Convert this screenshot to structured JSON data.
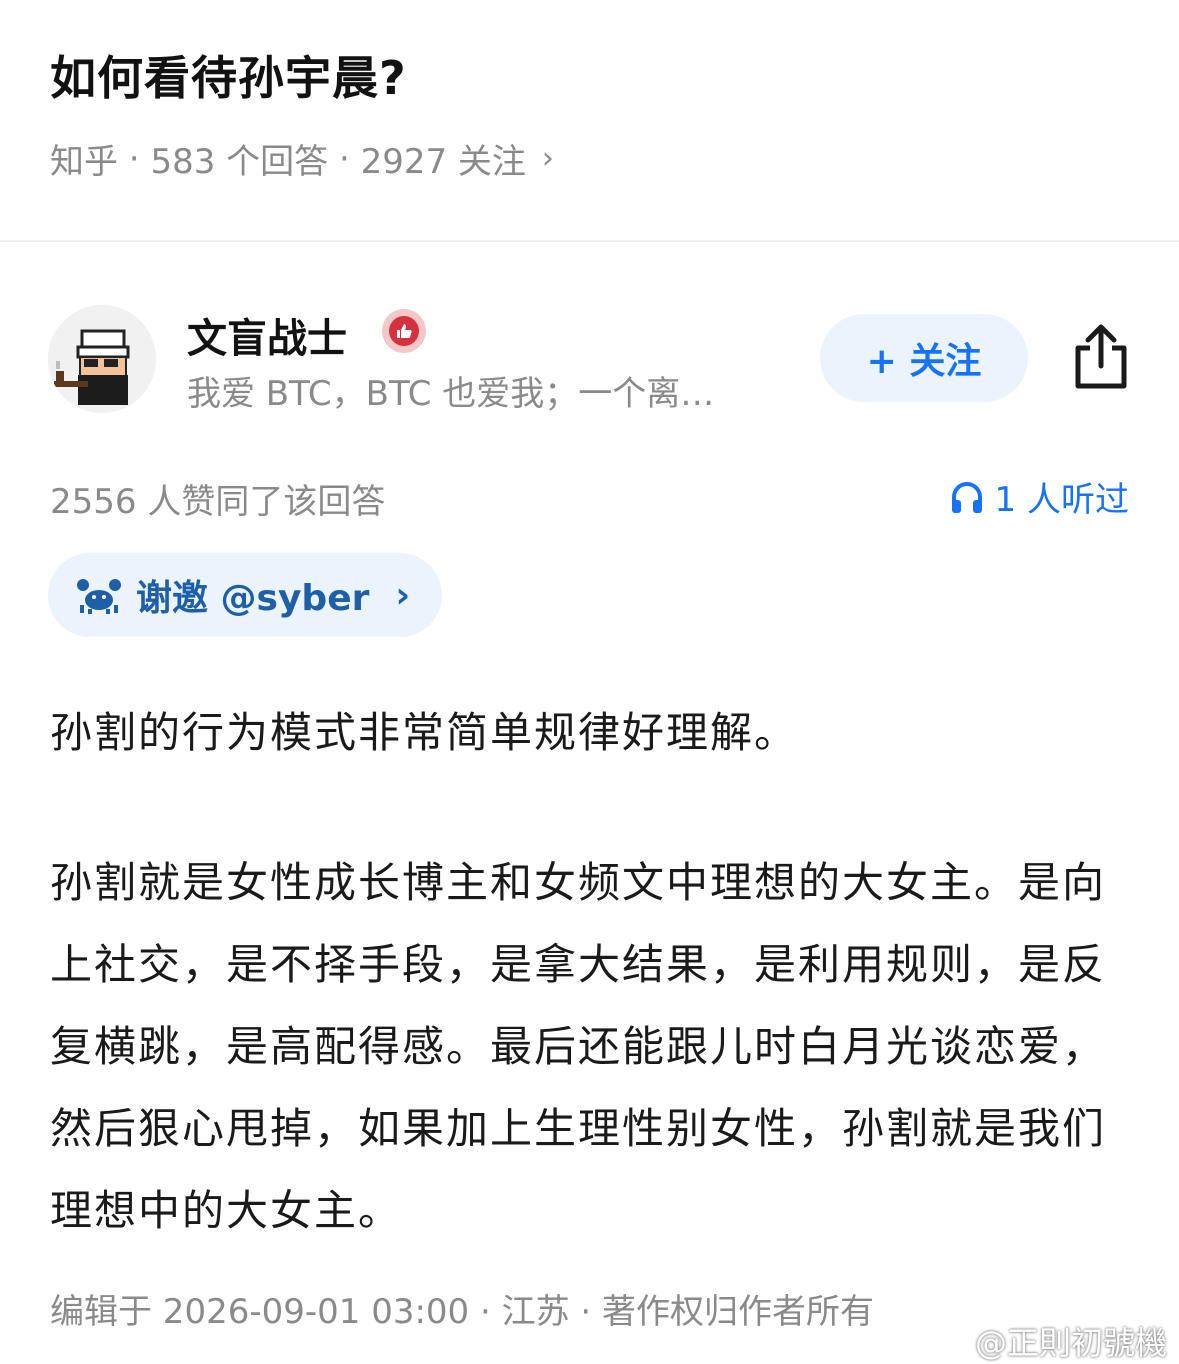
{
  "question": {
    "title": "如何看待孙宇晨?",
    "source": "知乎",
    "answers": "583 个回答",
    "followers": "2927 关注"
  },
  "author": {
    "name": "文盲战士",
    "bio": "我爱 BTC，BTC 也爱我；一个离…",
    "follow_label": "+ 关注"
  },
  "answer": {
    "votes": "2556 人赞同了该回答",
    "listened": "1 人听过",
    "invite_label": "谢邀 @syber",
    "paragraph1": "孙割的行为模式非常简单规律好理解。",
    "paragraph2_plain": "孙割就是女性成长博主和女频文中理想的大女主。是向上社交，是不择手段，是拿大结果，是利用规则，是反复横跳，是高配得感。最后还能跟儿时白月光谈恋爱，然后狠心甩掉，",
    "paragraph2_highlight": "如果加上生理性别女性，孙割就是我们理想中的大女主。",
    "footer": "编辑于 2026-09-01 03:00 · 江苏 · 著作权归作者所有"
  },
  "watermark": "@正則初號機",
  "colors": {
    "accent": "#1772f6",
    "muted": "#8a8a8a",
    "pill_bg": "#ebf3fd",
    "badge": "#d6313e"
  },
  "icons": [
    "chevron-right-icon",
    "share-icon",
    "headphones-icon",
    "crab-icon",
    "thumbs-up-badge-icon",
    "weibo-icon"
  ]
}
